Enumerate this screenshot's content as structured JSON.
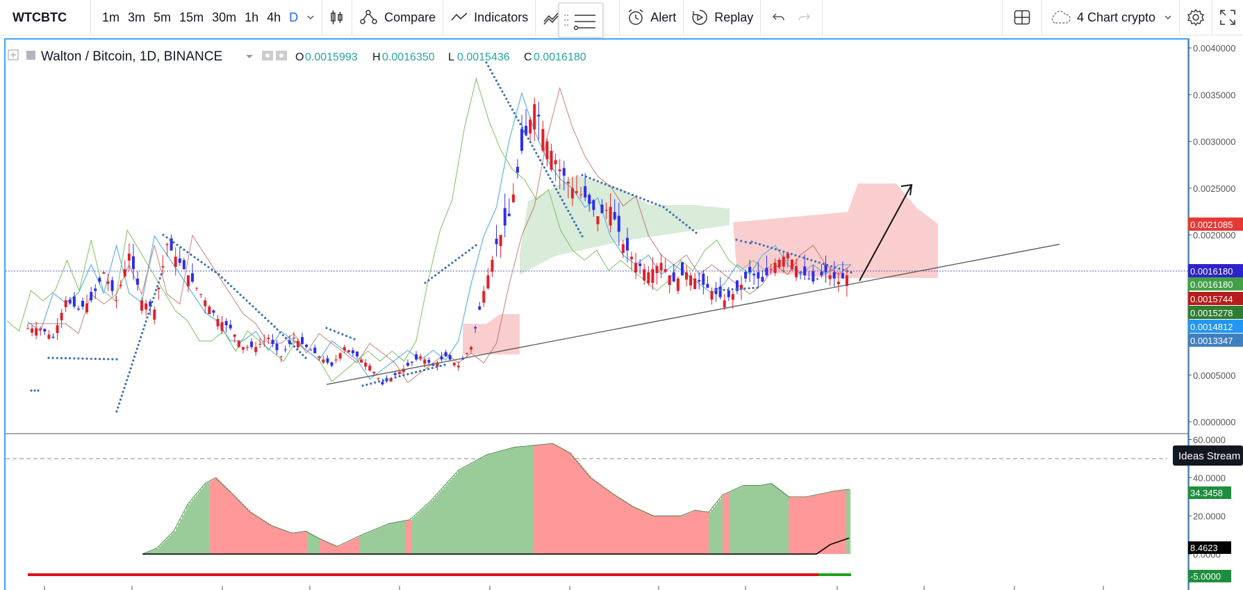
{
  "toolbar": {
    "symbol": "WTCBTC",
    "intervals": [
      "1m",
      "3m",
      "5m",
      "15m",
      "30m",
      "1h",
      "4h",
      "D"
    ],
    "active_interval": "D",
    "compare_label": "Compare",
    "indicators_label": "Indicators",
    "templates_label": "s",
    "alert_label": "Alert",
    "replay_label": "Replay",
    "layout_name": "4 Chart crypto"
  },
  "legend": {
    "title": "Walton / Bitcoin, 1D, BINANCE",
    "o_label": "O",
    "o_value": "0.0015993",
    "h_label": "H",
    "h_value": "0.0016350",
    "l_label": "L",
    "l_value": "0.0015436",
    "c_label": "C",
    "c_value": "0.0016180"
  },
  "price_axis": {
    "ticks": [
      "0.0040000",
      "0.0035000",
      "0.0030000",
      "0.0025000",
      "0.0020000",
      "0.0005000",
      "0.0000000"
    ],
    "tags": [
      {
        "value": "0.0021085",
        "color": "#e53935"
      },
      {
        "value": "0.0016180",
        "color": "#2e22c9"
      },
      {
        "value": "0.0016180",
        "color": "#43a047"
      },
      {
        "value": "0.0015744",
        "color": "#b71c1c"
      },
      {
        "value": "0.0015278",
        "color": "#2e7d32"
      },
      {
        "value": "0.0014812",
        "color": "#2196f3"
      },
      {
        "value": "0.0013347",
        "color": "#3f7fbf"
      }
    ]
  },
  "osc_axis": {
    "ticks": [
      "60.0000",
      "40.0000",
      "20.0000",
      "0.0000"
    ],
    "tags": [
      {
        "value": "34.3458",
        "color": "#1e8e3e"
      },
      {
        "value": "8.4623",
        "color": "#000000"
      },
      {
        "value": "-5.0000",
        "color": "#1e8e3e"
      }
    ]
  },
  "ideas_stream_label": "Ideas Stream",
  "colors": {
    "up_candle": "#2d2df0",
    "down_candle": "#e0202a",
    "psar": "#3d6fb3",
    "tenkan": "#5db4e6",
    "kijun": "#b34747",
    "chikou": "#7bc05e",
    "cloud_bull": "#cfe6cf",
    "cloud_bear": "#f9c9c9",
    "hist_green": "#99cc99",
    "hist_red": "#ff9999",
    "frame": "#42a5f5"
  },
  "chart_data": {
    "type": "candlestick",
    "symbol": "WTCBTC",
    "timeframe": "1D",
    "exchange": "BINANCE",
    "ylim": [
      0,
      0.0041
    ],
    "last": {
      "open": 0.0015993,
      "high": 0.001635,
      "low": 0.0015436,
      "close": 0.001618
    },
    "close_trace": [
      0.001,
      0.0009,
      0.0013,
      0.0012,
      0.0013,
      0.0016,
      0.0013,
      0.0018,
      0.0013,
      0.0012,
      0.0019,
      0.0017,
      0.0015,
      0.0013,
      0.0011,
      0.001,
      0.0008,
      0.0008,
      0.0009,
      0.0007,
      0.0009,
      0.0008,
      0.0007,
      0.0006,
      0.0008,
      0.0007,
      0.0006,
      0.0004,
      0.0005,
      0.0006,
      0.0007,
      0.0006,
      0.0007,
      0.0006,
      0.0008,
      0.0014,
      0.0019,
      0.0022,
      0.0029,
      0.0034,
      0.003,
      0.0027,
      0.0025,
      0.0024,
      0.0022,
      0.0023,
      0.0019,
      0.0017,
      0.0016,
      0.0017,
      0.0015,
      0.0016,
      0.0015,
      0.0014,
      0.0013,
      0.0014,
      0.0016,
      0.0015,
      0.0017,
      0.0018,
      0.0016,
      0.0015,
      0.0016,
      0.0015,
      0.0016,
      0.0016
    ],
    "trendline": {
      "points": [
        [
          0.0,
          0.0004
        ],
        [
          1.0,
          0.0019
        ]
      ]
    },
    "oscillator": {
      "ylim": [
        -5,
        62
      ],
      "reference_level": 50,
      "last_values": [
        34.3458,
        8.4623,
        -5.0
      ]
    }
  }
}
